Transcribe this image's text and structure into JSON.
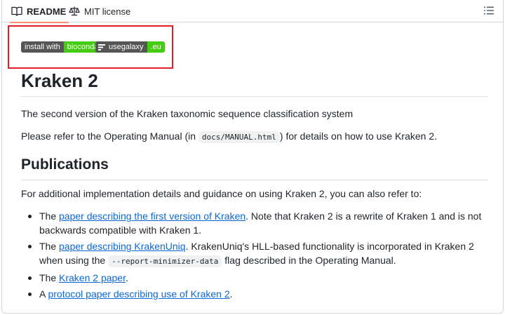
{
  "tabs": {
    "readme": "README",
    "license": "MIT license"
  },
  "badges": [
    {
      "left": "install with",
      "right": "bioconda",
      "color_left": "#555555",
      "color_right": "#44cc11"
    },
    {
      "left": "usegalaxy",
      "right": ".eu",
      "color_left": "#555555",
      "color_right": "#44cc11",
      "icon": "galaxy-icon"
    }
  ],
  "highlight_color": "#e11d2a",
  "title": "Kraken 2",
  "intro": "The second version of the Kraken taxonomic sequence classification system",
  "manual": {
    "before": "Please refer to the Operating Manual (in ",
    "code": "docs/MANUAL.html",
    "after": ") for details on how to use Kraken 2."
  },
  "publications": {
    "heading": "Publications",
    "intro": "For additional implementation details and guidance on using Kraken 2, you can also refer to:",
    "items": [
      {
        "pre": "The ",
        "link": "paper describing the first version of Kraken",
        "post": ". Note that Kraken 2 is a rewrite of Kraken 1 and is not backwards compatible with Kraken 1."
      },
      {
        "pre": "The ",
        "link": "paper describing KrakenUniq",
        "mid": ". KrakenUniq's HLL-based functionality is incorporated in Kraken 2 when using the ",
        "code": "--report-minimizer-data",
        "post": " flag described in the Operating Manual."
      },
      {
        "pre": "The ",
        "link": "Kraken 2 paper",
        "post": "."
      },
      {
        "pre": "A ",
        "link": "protocol paper describing use of Kraken 2",
        "post": "."
      }
    ]
  },
  "link_color": "#0969da"
}
